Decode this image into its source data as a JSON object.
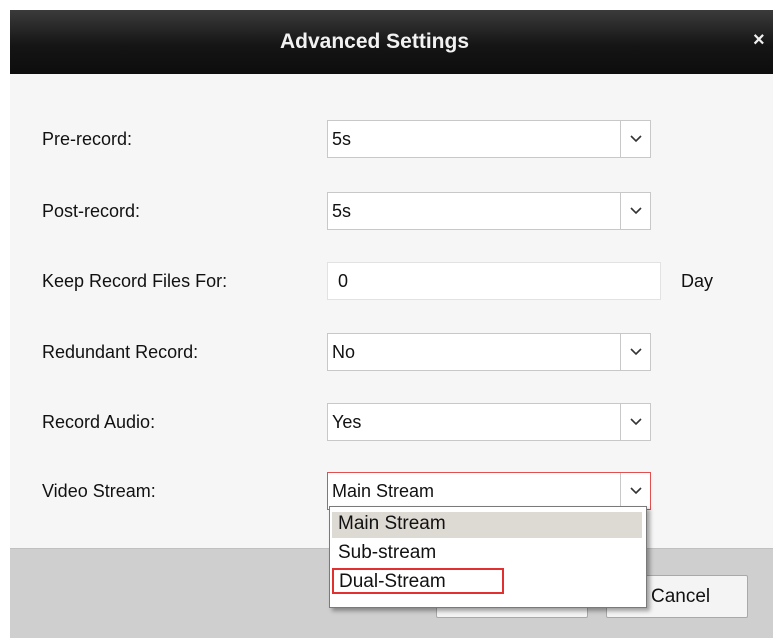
{
  "dialog": {
    "title": "Advanced Settings",
    "close_glyph": "×"
  },
  "fields": {
    "pre_record": {
      "label": "Pre-record:",
      "value": "5s"
    },
    "post_record": {
      "label": "Post-record:",
      "value": "5s"
    },
    "keep_files": {
      "label": "Keep Record Files For:",
      "value": "0",
      "unit": "Day"
    },
    "redundant": {
      "label": "Redundant Record:",
      "value": "No"
    },
    "audio": {
      "label": "Record Audio:",
      "value": "Yes"
    },
    "video_stream": {
      "label": "Video Stream:",
      "value": "Main Stream"
    }
  },
  "video_stream_dropdown": {
    "options": [
      "Main Stream",
      "Sub-stream",
      "Dual-Stream"
    ],
    "highlighted": "Main Stream",
    "boxed": "Dual-Stream"
  },
  "buttons": {
    "cancel": "Cancel"
  },
  "colors": {
    "titlebar": "#151515",
    "focus_border": "#e05050",
    "annotation_box": "#e03030"
  },
  "icons": {
    "dropdown_arrow": "chevron-down-icon",
    "close": "close-icon"
  }
}
